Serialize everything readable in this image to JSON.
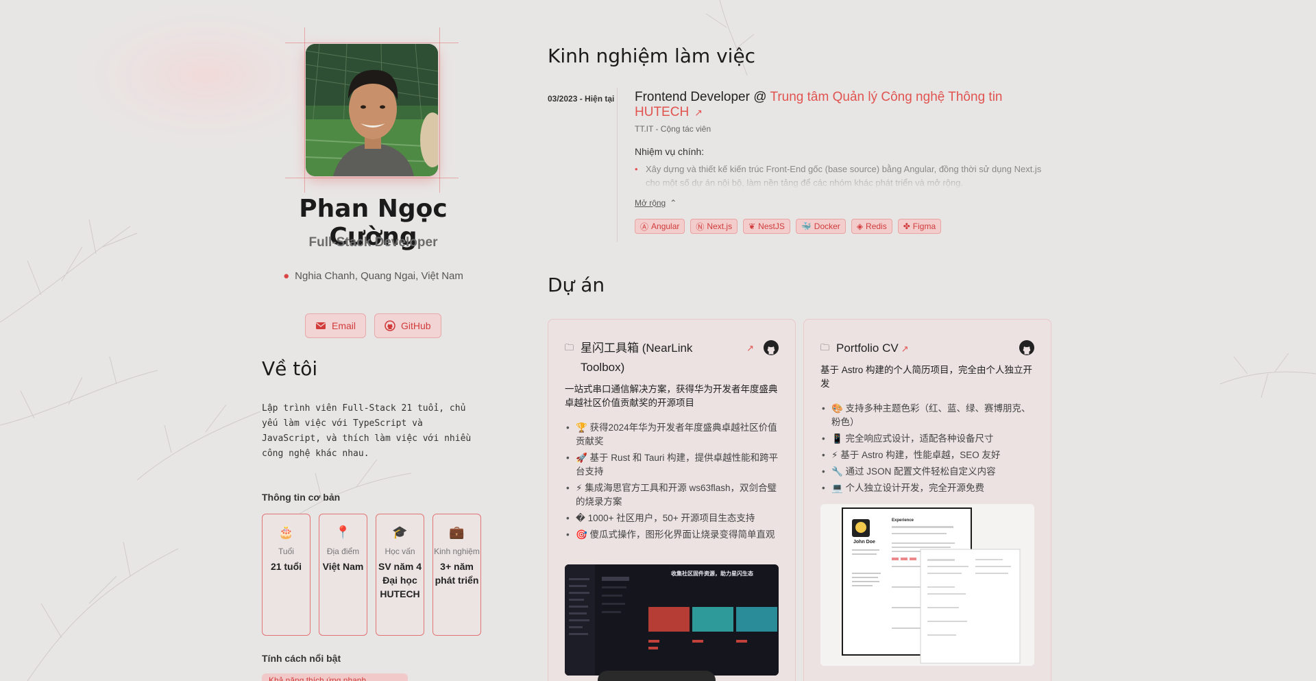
{
  "profile": {
    "name": "Phan Ngọc Cường",
    "role": "Full-Stack Developer",
    "location": "Nghia Chanh, Quang Ngai, Việt Nam",
    "email_label": "Email",
    "github_label": "GitHub"
  },
  "about": {
    "heading": "Về tôi",
    "text": "Lập trình viên Full-Stack 21 tuổi, chủ yếu làm việc với TypeScript và JavaScript, và thích làm việc với nhiều công nghệ khác nhau."
  },
  "info": {
    "heading": "Thông tin cơ bản",
    "cards": [
      {
        "icon": "cake-icon",
        "glyph": "🎂",
        "label": "Tuổi",
        "value": "21 tuổi"
      },
      {
        "icon": "pin-icon",
        "glyph": "📍",
        "label": "Địa điểm",
        "value": "Việt Nam"
      },
      {
        "icon": "graduation-cap-icon",
        "glyph": "🎓",
        "label": "Học vấn",
        "value": "SV năm 4 Đại học HUTECH"
      },
      {
        "icon": "briefcase-icon",
        "glyph": "💼",
        "label": "Kinh nghiệm",
        "value": "3+ năm phát triển"
      }
    ]
  },
  "traits": {
    "heading": "Tính cách nổi bật",
    "first": "Khả năng thích ứng nhanh"
  },
  "experience": {
    "heading": "Kinh nghiệm làm việc",
    "date": "03/2023 - Hiện tại",
    "title_prefix": "Frontend Developer @ ",
    "company": "Trung tâm Quản lý Công nghệ Thông tin HUTECH",
    "subtitle": "TT.IT - Cộng tác viên",
    "tasks_heading": "Nhiệm vụ chính:",
    "task": "Xây dựng và thiết kế kiến trúc Front-End gốc (base source) bằng Angular, đồng thời sử dụng Next.js cho một số dự án nội bộ, làm nền tảng để các nhóm khác phát triển và mở rộng.",
    "expand_label": "Mở rộng",
    "tags": [
      {
        "icon": "angular-icon",
        "glyph": "Ⓐ",
        "label": "Angular"
      },
      {
        "icon": "nextjs-icon",
        "glyph": "Ⓝ",
        "label": "Next.js"
      },
      {
        "icon": "nestjs-icon",
        "glyph": "❦",
        "label": "NestJS"
      },
      {
        "icon": "docker-icon",
        "glyph": "🐳",
        "label": "Docker"
      },
      {
        "icon": "redis-icon",
        "glyph": "◈",
        "label": "Redis"
      },
      {
        "icon": "figma-icon",
        "glyph": "✤",
        "label": "Figma"
      }
    ]
  },
  "projects": {
    "heading": "Dự án",
    "items": [
      {
        "title": "星闪工具箱 (NearLink Toolbox)",
        "description": "一站式串口通信解决方案，获得华为开发者年度盛典卓越社区价值贡献奖的开源项目",
        "features": [
          "🏆 获得2024年华为开发者年度盛典卓越社区价值贡献奖",
          "🚀 基于 Rust 和 Tauri 构建，提供卓越性能和跨平台支持",
          "⚡ 集成海思官方工具和开源 ws63flash，双剑合璧的烧录方案",
          "� 1000+ 社区用户，50+ 开源项目生态支持",
          "🎯 傻瓜式操作，图形化界面让烧录变得简单直观"
        ],
        "screenshot_caption": "收集社区固件资源，助力星闪生态"
      },
      {
        "title": "Portfolio CV",
        "description": "基于 Astro 构建的个人简历项目，完全由个人独立开发",
        "features": [
          "🎨 支持多种主题色彩（红、蓝、绿、赛博朋克、粉色）",
          "📱 完全响应式设计，适配各种设备尺寸",
          "⚡ 基于 Astro 构建，性能卓越，SEO 友好",
          "🔧 通过 JSON 配置文件轻松自定义内容",
          "💻 个人独立设计开发，完全开源免费"
        ],
        "screenshot_name": "John Doe",
        "screenshot_heading": "Experience"
      }
    ]
  },
  "colors": {
    "accent": "#e0534f",
    "background": "#e8e6e5",
    "card": "#ece2e2"
  }
}
